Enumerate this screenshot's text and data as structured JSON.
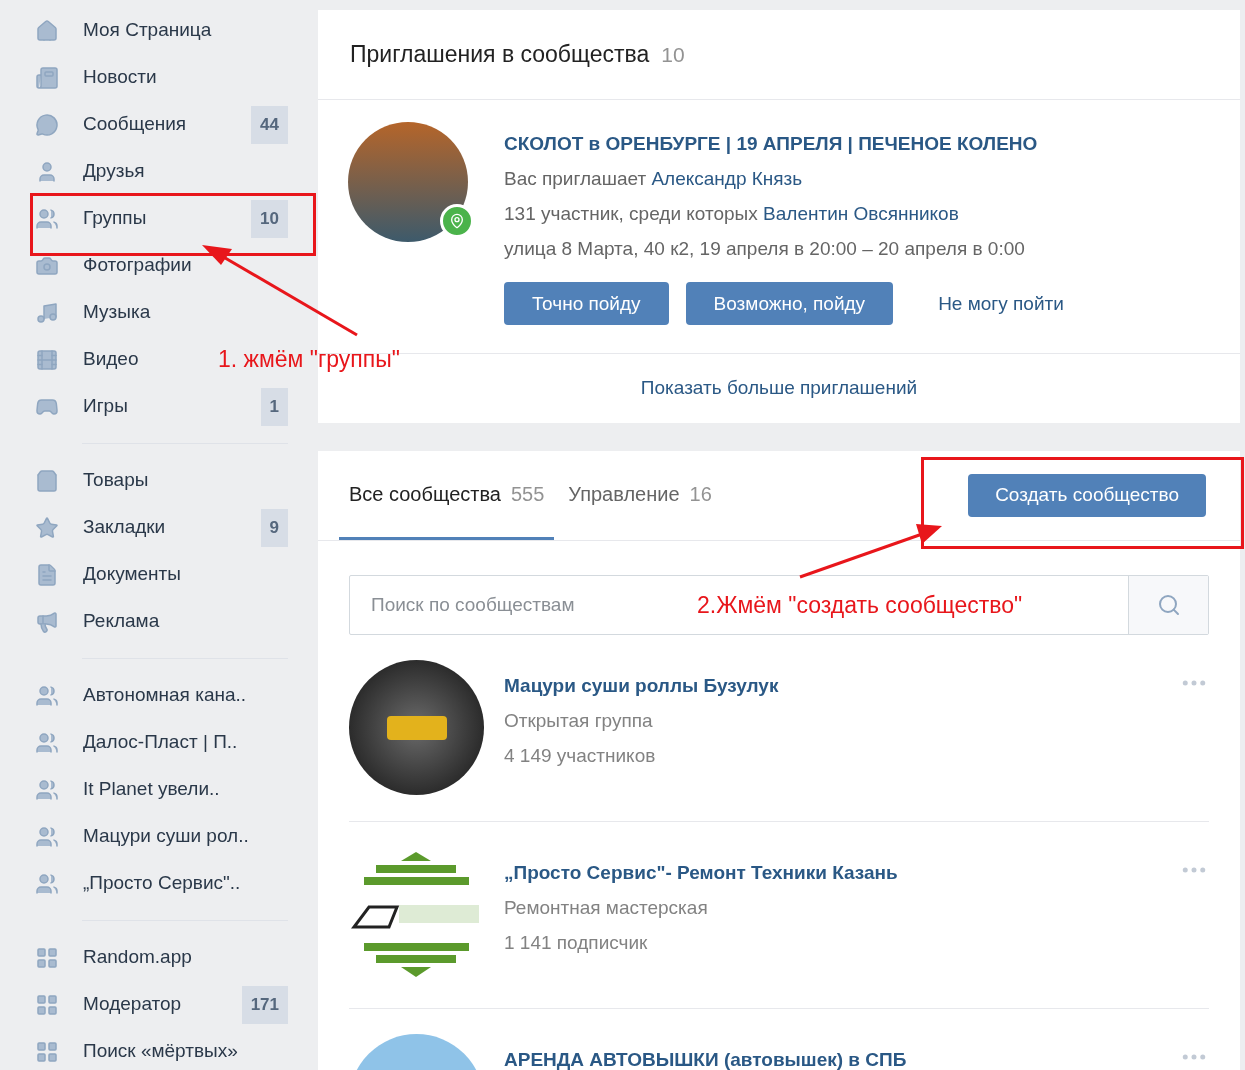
{
  "sidebar": {
    "sections": [
      {
        "items": [
          {
            "label": "Моя Страница"
          },
          {
            "label": "Новости"
          },
          {
            "label": "Сообщения",
            "counter": "44"
          },
          {
            "label": "Друзья"
          },
          {
            "label": "Группы",
            "counter": "10"
          },
          {
            "label": "Фотографии"
          },
          {
            "label": "Музыка"
          },
          {
            "label": "Видео"
          },
          {
            "label": "Игры",
            "counter": "1"
          }
        ]
      },
      {
        "items": [
          {
            "label": "Товары"
          },
          {
            "label": "Закладки",
            "counter": "9"
          },
          {
            "label": "Документы"
          },
          {
            "label": "Реклама"
          }
        ]
      },
      {
        "items": [
          {
            "label": "Автономная кана.."
          },
          {
            "label": "Далос-Пласт | П.."
          },
          {
            "label": "It Planet увели.."
          },
          {
            "label": "Мацури суши рол.."
          },
          {
            "label": "„Просто Сервис\".."
          }
        ]
      },
      {
        "items": [
          {
            "label": "Random.app"
          },
          {
            "label": "Модератор",
            "counter": "171"
          },
          {
            "label": "Поиск «мёртвых»"
          }
        ]
      }
    ]
  },
  "invitations": {
    "title": "Приглашения в сообщества",
    "count": "10",
    "event": {
      "name": "СКОЛОТ в ОРЕНБУРГЕ | 19 АПРЕЛЯ | ПЕЧЕНОЕ КОЛЕНО",
      "inviter_prefix": "Вас приглашает",
      "inviter": "Александр Князь",
      "members_prefix": "131 участник, среди которых",
      "member": "Валентин Овсянников",
      "details": "улица 8 Марта, 40 к2, 19 апреля в 20:00 – 20 апреля в 0:00",
      "buttons": [
        {
          "label": "Точно пойду",
          "kind": "primary"
        },
        {
          "label": "Возможно, пойду",
          "kind": "primary"
        },
        {
          "label": "Не могу пойти",
          "kind": "link"
        }
      ]
    },
    "show_more": "Показать больше приглашений"
  },
  "communities": {
    "tabs": [
      {
        "label": "Все сообщества",
        "count": "555",
        "selected": true
      },
      {
        "label": "Управление",
        "count": "16",
        "selected": false
      }
    ],
    "create_button": "Создать сообщество",
    "search": {
      "placeholder": "Поиск по сообществам"
    },
    "groups": [
      {
        "name": "Мацури суши роллы Бузулук",
        "type": "Открытая группа",
        "members": "4 149 участников"
      },
      {
        "name": "„Просто Сервис\"- Ремонт Техники Казань",
        "type": "Ремонтная мастерская",
        "members": "1 141 подписчик"
      },
      {
        "name": "АРЕНДА АВТОВЫШКИ (автовышек) в СПБ"
      }
    ]
  },
  "annotations": [
    {
      "text": "1. жмём \"группы\""
    },
    {
      "text": "2.Жмём \"создать сообщество\""
    }
  ]
}
